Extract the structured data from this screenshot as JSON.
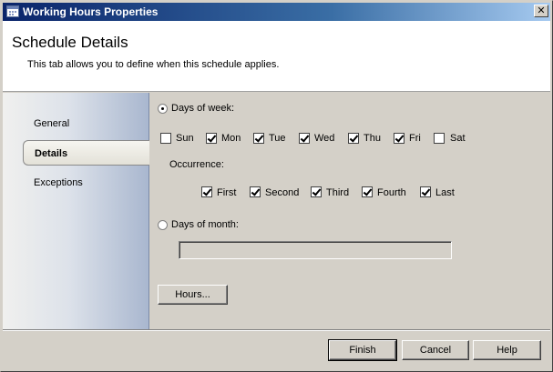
{
  "window": {
    "title": "Working Hours Properties",
    "close_glyph": "✕"
  },
  "header": {
    "title": "Schedule Details",
    "subtitle": "This tab allows you to define when this schedule applies."
  },
  "sidebar": {
    "items": [
      {
        "label": "General",
        "active": false
      },
      {
        "label": "Details",
        "active": true
      },
      {
        "label": "Exceptions",
        "active": false
      }
    ]
  },
  "details": {
    "days_of_week": {
      "label": "Days of week:",
      "selected": true
    },
    "weekdays": [
      {
        "label": "Sun",
        "checked": false
      },
      {
        "label": "Mon",
        "checked": true
      },
      {
        "label": "Tue",
        "checked": true
      },
      {
        "label": "Wed",
        "checked": true
      },
      {
        "label": "Thu",
        "checked": true
      },
      {
        "label": "Fri",
        "checked": true
      },
      {
        "label": "Sat",
        "checked": false
      }
    ],
    "occurrence": {
      "label": "Occurrence:",
      "items": [
        {
          "label": "First",
          "checked": true
        },
        {
          "label": "Second",
          "checked": true
        },
        {
          "label": "Third",
          "checked": true
        },
        {
          "label": "Fourth",
          "checked": true
        },
        {
          "label": "Last",
          "checked": true
        }
      ]
    },
    "days_of_month": {
      "label": "Days of month:",
      "selected": false,
      "value": ""
    },
    "hours_button": "Hours..."
  },
  "footer": {
    "finish": "Finish",
    "cancel": "Cancel",
    "help": "Help"
  }
}
